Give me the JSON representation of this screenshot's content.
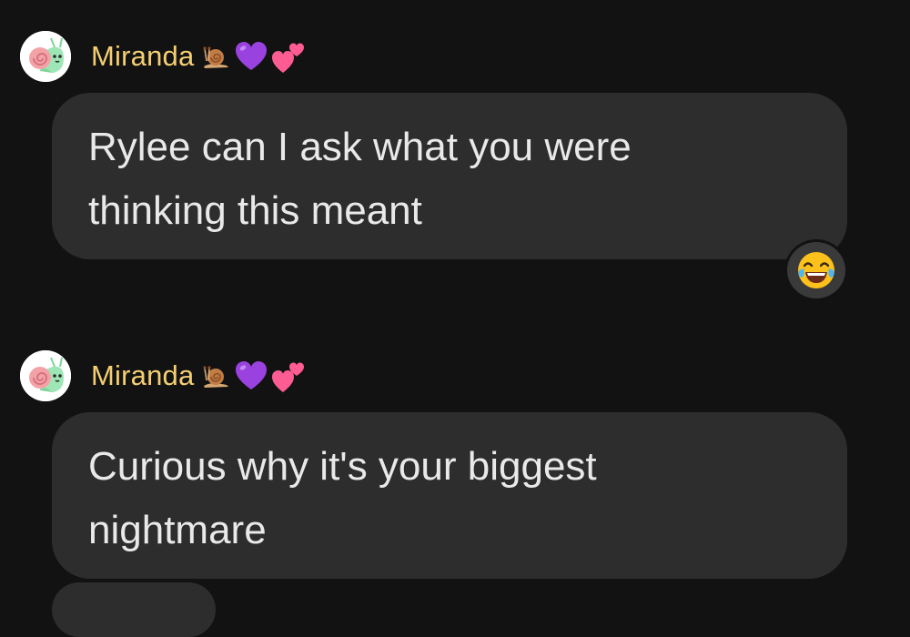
{
  "messages": [
    {
      "sender": "Miranda",
      "sender_emojis": [
        "snail-emoji",
        "purple-heart-emoji",
        "two-hearts-emoji"
      ],
      "lines": [
        "Rylee can I ask what you were",
        "thinking this meant"
      ],
      "reaction": "tears-of-joy-emoji"
    },
    {
      "sender": "Miranda",
      "sender_emojis": [
        "snail-emoji",
        "purple-heart-emoji",
        "two-hearts-emoji"
      ],
      "lines": [
        "Curious why it's your biggest",
        "nightmare"
      ]
    }
  ],
  "colors": {
    "background": "#121212",
    "bubble": "#2d2d2d",
    "sender_name": "#f4cf72",
    "message_text": "#e9e9e9"
  }
}
